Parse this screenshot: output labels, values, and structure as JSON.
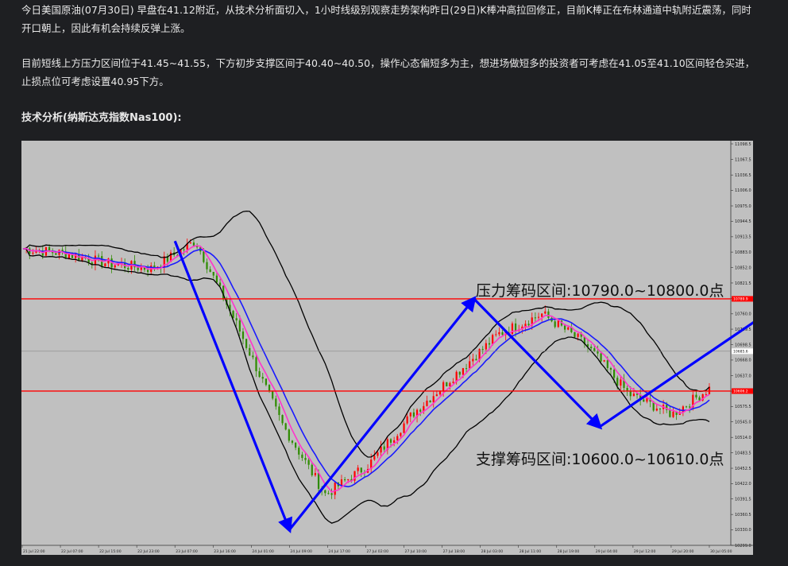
{
  "article": {
    "paragraph1": "今日美国原油(07月30日) 早盘在41.12附近，从技术分析面切入，1小时线级别观察走势架构昨日(29日)K棒冲高拉回修正，目前K棒正在布林通道中轨附近震荡，同时开口朝上，因此有机会持续反弹上涨。",
    "paragraph2": "目前短线上方压力区间位于41.45~41.55，下方初步支撑区间于40.40~40.50，操作心态偏短多为主，想进场做短多的投资者可考虑在41.05至41.10区间轻仓买进，止损点位可考虑设置40.95下方。",
    "heading": "技术分析(纳斯达克指数Nas100):"
  },
  "chart": {
    "resistance_label": "压力筹码区间:10790.0~10800.0点",
    "support_label": "支撑筹码区间:10600.0~10610.0点",
    "resistance_tag": "10789.9",
    "support_tag": "10606.2",
    "current_tag": "10685.6",
    "colors": {
      "background": "#c0c0c0",
      "bollinger": "#000000",
      "ma_fast": "#ff33cc",
      "ma_slow": "#1a1aff",
      "zone_line": "#ff0000",
      "arrow": "#0000ff",
      "candle_up": "#ff0000",
      "candle_down": "#2e8b00"
    }
  },
  "chart_data": {
    "type": "candlestick",
    "title": "",
    "y_ticks": [
      "11098.5",
      "11067.5",
      "11036.5",
      "11006.0",
      "10975.0",
      "10944.5",
      "10913.5",
      "10883.0",
      "10852.0",
      "10821.5",
      "10790.5",
      "10760.0",
      "10729.5",
      "10698.5",
      "10668.0",
      "10637.0",
      "10606.0",
      "10575.5",
      "10545.0",
      "10514.0",
      "10483.5",
      "10452.5",
      "10422.0",
      "10391.5",
      "10360.5",
      "10330.0",
      "10299.0"
    ],
    "x_ticks": [
      "21 Jul 22:00",
      "22 Jul 07:00",
      "22 Jul 15:00",
      "22 Jul 23:00",
      "23 Jul 07:00",
      "23 Jul 16:00",
      "24 Jul 01:00",
      "24 Jul 09:00",
      "24 Jul 17:00",
      "27 Jul 02:00",
      "27 Jul 10:00",
      "27 Jul 18:00",
      "28 Jul 03:00",
      "28 Jul 11:00",
      "28 Jul 19:00",
      "29 Jul 04:00",
      "29 Jul 12:00",
      "29 Jul 20:00",
      "30 Jul 05:00"
    ],
    "ylim": [
      10299.0,
      11098.5
    ],
    "horizontal_lines": [
      {
        "name": "resistance",
        "value": 10789.9
      },
      {
        "name": "support",
        "value": 10606.2
      },
      {
        "name": "current",
        "value": 10685.6
      }
    ],
    "close_path": [
      {
        "x": "21 Jul 22:00",
        "close": 10890
      },
      {
        "x": "22 Jul 07:00",
        "close": 10880
      },
      {
        "x": "22 Jul 15:00",
        "close": 10860
      },
      {
        "x": "22 Jul 23:00",
        "close": 10850
      },
      {
        "x": "23 Jul 07:00",
        "close": 10905
      },
      {
        "x": "23 Jul 16:00",
        "close": 10730
      },
      {
        "x": "24 Jul 01:00",
        "close": 10540
      },
      {
        "x": "24 Jul 09:00",
        "close": 10400
      },
      {
        "x": "24 Jul 17:00",
        "close": 10460
      },
      {
        "x": "27 Jul 02:00",
        "close": 10560
      },
      {
        "x": "27 Jul 10:00",
        "close": 10640
      },
      {
        "x": "27 Jul 18:00",
        "close": 10720
      },
      {
        "x": "28 Jul 03:00",
        "close": 10760
      },
      {
        "x": "28 Jul 11:00",
        "close": 10700
      },
      {
        "x": "28 Jul 19:00",
        "close": 10600
      },
      {
        "x": "29 Jul 04:00",
        "close": 10560
      },
      {
        "x": "29 Jul 12:00",
        "close": 10620
      },
      {
        "x": "29 Jul 20:00",
        "close": 10700
      },
      {
        "x": "30 Jul 05:00",
        "close": 10685.6
      }
    ]
  }
}
